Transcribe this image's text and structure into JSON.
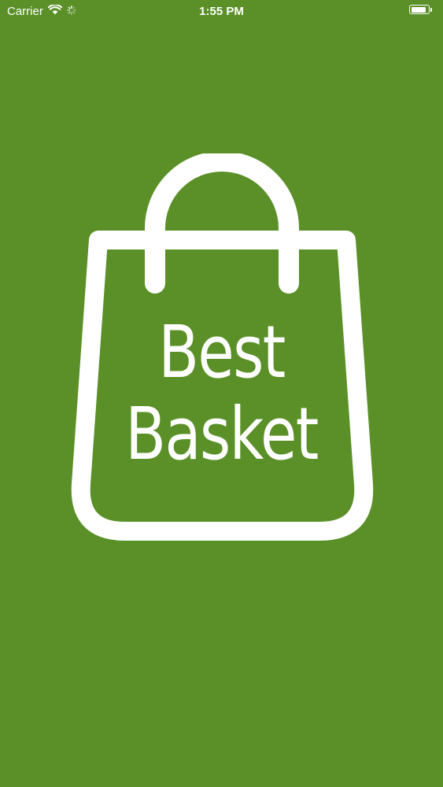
{
  "status_bar": {
    "carrier": "Carrier",
    "time": "1:55 PM",
    "icons": [
      "wifi-icon",
      "activity-spinner-icon",
      "battery-icon"
    ],
    "battery_level": 0.9
  },
  "splash": {
    "brand_line_1": "Best",
    "brand_line_2": "Basket",
    "logo_icon": "shopping-bag-icon"
  },
  "colors": {
    "background": "#5a9027",
    "foreground": "#ffffff"
  }
}
